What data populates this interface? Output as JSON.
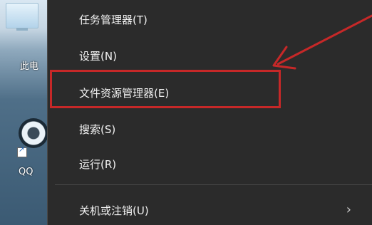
{
  "desktop": {
    "pc_label": "此电",
    "qq_label": "QQ"
  },
  "menu": {
    "items": [
      {
        "label": "任务管理器(T)"
      },
      {
        "label": "设置(N)"
      },
      {
        "label": "文件资源管理器(E)"
      },
      {
        "label": "搜索(S)"
      },
      {
        "label": "运行(R)"
      },
      {
        "label": "关机或注销(U)"
      }
    ],
    "submenu_arrow": "›"
  },
  "annotation": {
    "highlight_color": "#c62828",
    "arrow_color": "#c62828"
  }
}
